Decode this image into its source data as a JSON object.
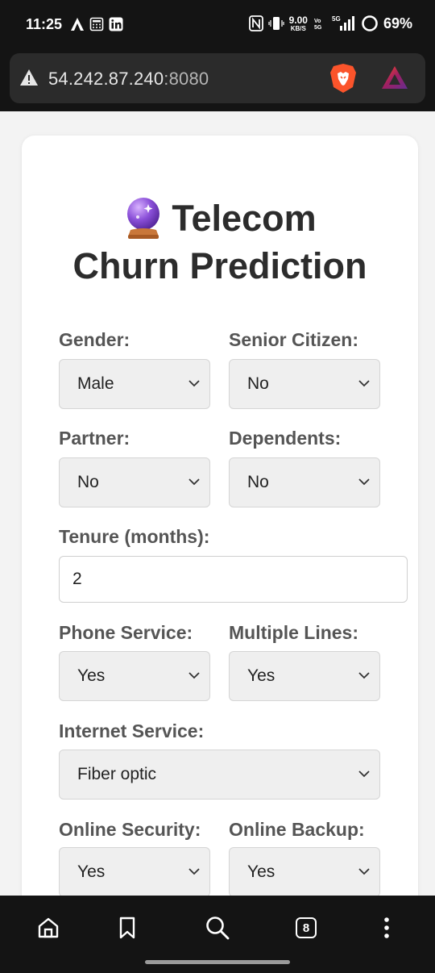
{
  "status_bar": {
    "time": "11:25",
    "net_speed_value": "9.00",
    "net_speed_unit": "KB/S",
    "battery": "69%"
  },
  "url_bar": {
    "host": "54.242.87.240",
    "port": ":8080"
  },
  "form": {
    "title_line1": "Telecom",
    "title_line2": "Churn Prediction",
    "gender": {
      "label": "Gender:",
      "value": "Male"
    },
    "senior_citizen": {
      "label": "Senior Citizen:",
      "value": "No"
    },
    "partner": {
      "label": "Partner:",
      "value": "No"
    },
    "dependents": {
      "label": "Dependents:",
      "value": "No"
    },
    "tenure": {
      "label": "Tenure (months):",
      "value": "2"
    },
    "phone_service": {
      "label": "Phone Service:",
      "value": "Yes"
    },
    "multiple_lines": {
      "label": "Multiple Lines:",
      "value": "Yes"
    },
    "internet_service": {
      "label": "Internet Service:",
      "value": "Fiber optic"
    },
    "online_security": {
      "label": "Online Security:",
      "value": "Yes"
    },
    "online_backup": {
      "label": "Online Backup:",
      "value": "Yes"
    }
  },
  "bottom_nav": {
    "tab_count": "8"
  },
  "colors": {
    "chrome_bg": "#141414",
    "url_box": "#2b2b2b",
    "page_bg": "#f3f3f3",
    "select_bg": "#efefef",
    "label": "#555555",
    "title": "#2c2c2c"
  }
}
